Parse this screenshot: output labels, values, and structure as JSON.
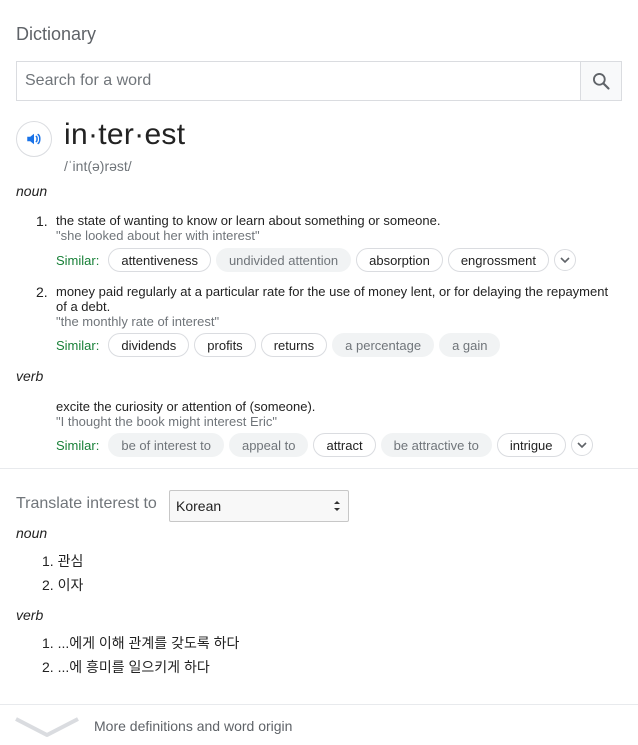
{
  "header": {
    "title": "Dictionary"
  },
  "search": {
    "placeholder": "Search for a word"
  },
  "entry": {
    "word": "in·ter·est",
    "phonetic": "/ˈint(ə)rəst/"
  },
  "noun": {
    "label": "noun",
    "definitions": [
      {
        "num": "1.",
        "text": "the state of wanting to know or learn about something or someone.",
        "example": "\"she looked about her with interest\"",
        "similar_label": "Similar:",
        "similar": [
          "attentiveness",
          "undivided attention",
          "absorption",
          "engrossment"
        ]
      },
      {
        "num": "2.",
        "text": "money paid regularly at a particular rate for the use of money lent, or for delaying the repayment of a debt.",
        "example": "\"the monthly rate of interest\"",
        "similar_label": "Similar:",
        "similar": [
          "dividends",
          "profits",
          "returns",
          "a percentage",
          "a gain"
        ]
      }
    ]
  },
  "verb": {
    "label": "verb",
    "definitions": [
      {
        "text": "excite the curiosity or attention of (someone).",
        "example": "\"I thought the book might interest Eric\"",
        "similar_label": "Similar:",
        "similar": [
          "be of interest to",
          "appeal to",
          "attract",
          "be attractive to",
          "intrigue"
        ]
      }
    ]
  },
  "translate": {
    "label": "Translate interest to",
    "selected_language": "Korean",
    "noun_label": "noun",
    "noun_items": [
      "1. 관심",
      "2. 이자"
    ],
    "verb_label": "verb",
    "verb_items": [
      "1. ...에게 이해 관계를 갖도록 하다",
      "2. ...에 흥미를 일으키게 하다"
    ]
  },
  "footer": {
    "text": "More definitions and word origin"
  },
  "colors": {
    "accent_blue": "#1a73e8",
    "similar_green": "#188038",
    "muted": "#70757a"
  },
  "icons": {
    "search": "search-icon",
    "speaker": "speaker-icon",
    "chevron": "chevron-down-icon"
  }
}
